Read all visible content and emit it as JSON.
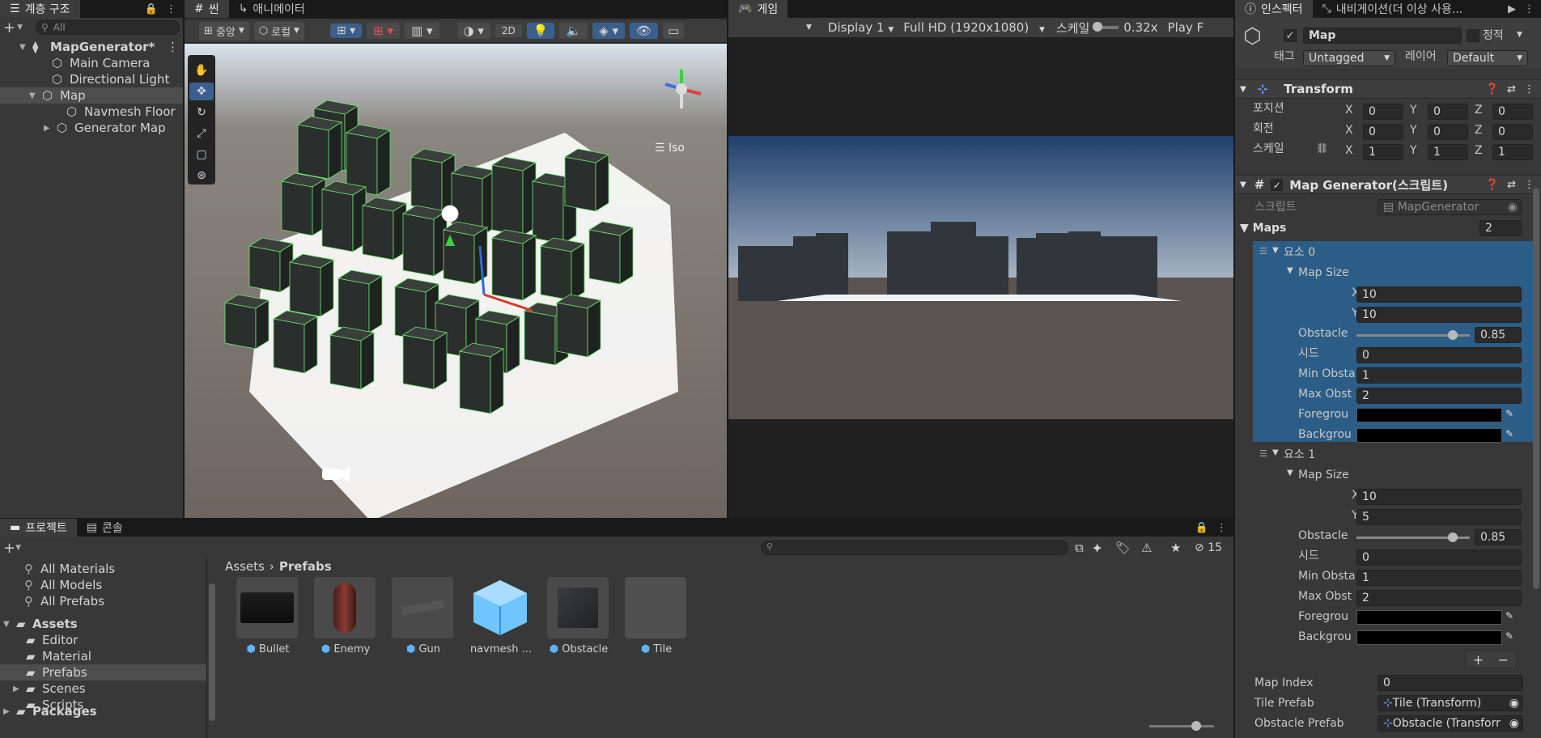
{
  "hierarchy": {
    "tab": "계층 구조",
    "search_placeholder": "All",
    "items": [
      {
        "label": "MapGenerator*",
        "icon": "unity-scene-icon",
        "bold": true,
        "arrow": "▼"
      },
      {
        "label": "Main Camera",
        "icon": "gameobject-cube-icon"
      },
      {
        "label": "Directional Light",
        "icon": "gameobject-cube-icon"
      },
      {
        "label": "Map",
        "icon": "gameobject-cube-icon",
        "arrow": "▼",
        "selected": true
      },
      {
        "label": "Navmesh Floor",
        "icon": "gameobject-cube-icon"
      },
      {
        "label": "Generator Map",
        "icon": "gameobject-cube-icon",
        "arrow": "▶"
      }
    ]
  },
  "scene": {
    "tabs": [
      "씬",
      "애니메이터"
    ],
    "toolbar": {
      "pivot": "중앙",
      "space": "로컬",
      "mode2d": "2D"
    },
    "iso_label": "Iso"
  },
  "game": {
    "tab": "게임",
    "display": "Display 1",
    "resolution": "Full HD (1920x1080)",
    "scale_label": "스케일",
    "scale_value": "0.32x",
    "play_label": "Play F"
  },
  "project": {
    "tabs": [
      "프로젝트",
      "콘솔"
    ],
    "badge_count": "15",
    "favorites": [
      "All Materials",
      "All Models",
      "All Prefabs"
    ],
    "tree": [
      {
        "label": "Assets",
        "bold": true,
        "arrow": "▼"
      },
      {
        "label": "Editor"
      },
      {
        "label": "Material"
      },
      {
        "label": "Prefabs",
        "selected": true
      },
      {
        "label": "Scenes",
        "arrow": "▶"
      },
      {
        "label": "Scripts"
      },
      {
        "label": "Packages",
        "bold": true,
        "arrow": "▶"
      }
    ],
    "breadcrumb": [
      "Assets",
      "Prefabs"
    ],
    "assets": [
      "Bullet",
      "Enemy",
      "Gun",
      "navmesh ...",
      "Obstacle",
      "Tile"
    ]
  },
  "inspector": {
    "tabs": [
      "인스펙터",
      "내비게이션(더 이상 사용..."
    ],
    "object_name": "Map",
    "static_label": "정적",
    "tag_label": "태그",
    "tag_value": "Untagged",
    "layer_label": "레이어",
    "layer_value": "Default",
    "transform": {
      "title": "Transform",
      "rows": [
        {
          "label": "포지션",
          "x": "0",
          "y": "0",
          "z": "0"
        },
        {
          "label": "회전",
          "x": "0",
          "y": "0",
          "z": "0"
        },
        {
          "label": "스케일",
          "x": "1",
          "y": "1",
          "z": "1"
        }
      ]
    },
    "script": {
      "title": "Map Generator(스크립트)",
      "script_label": "스크립트",
      "script_value": "MapGenerator",
      "maps_label": "Maps",
      "maps_count": "2",
      "elements": [
        {
          "title": "요소 0",
          "map_size": "Map Size",
          "x": "10",
          "y": "10",
          "obstacle_label": "Obstacle",
          "obstacle": "0.85",
          "obstacle_fraction": 0.85,
          "seed_label": "시드",
          "seed": "0",
          "min_label": "Min Obsta",
          "min": "1",
          "max_label": "Max Obst",
          "max": "2",
          "fg_label": "Foregrou",
          "bg_label": "Backgrou"
        },
        {
          "title": "요소 1",
          "map_size": "Map Size",
          "x": "10",
          "y": "5",
          "obstacle_label": "Obstacle",
          "obstacle": "0.85",
          "obstacle_fraction": 0.85,
          "seed_label": "시드",
          "seed": "0",
          "min_label": "Min Obsta",
          "min": "1",
          "max_label": "Max Obst",
          "max": "2",
          "fg_label": "Foregrou",
          "bg_label": "Backgrou"
        }
      ],
      "map_index_label": "Map Index",
      "map_index": "0",
      "tile_prefab_label": "Tile Prefab",
      "tile_prefab": "Tile (Transform)",
      "obstacle_prefab_label": "Obstacle Prefab",
      "obstacle_prefab": "Obstacle (Transforr"
    }
  },
  "colors": {
    "accent": "#2c5d87",
    "selection": "#2c5d87",
    "panel": "#383838",
    "cube_icon": "#5fb4ff",
    "sky_top": "#1f3f6e",
    "sky_bottom": "#a6b4c2",
    "ground": "#5a5350"
  }
}
